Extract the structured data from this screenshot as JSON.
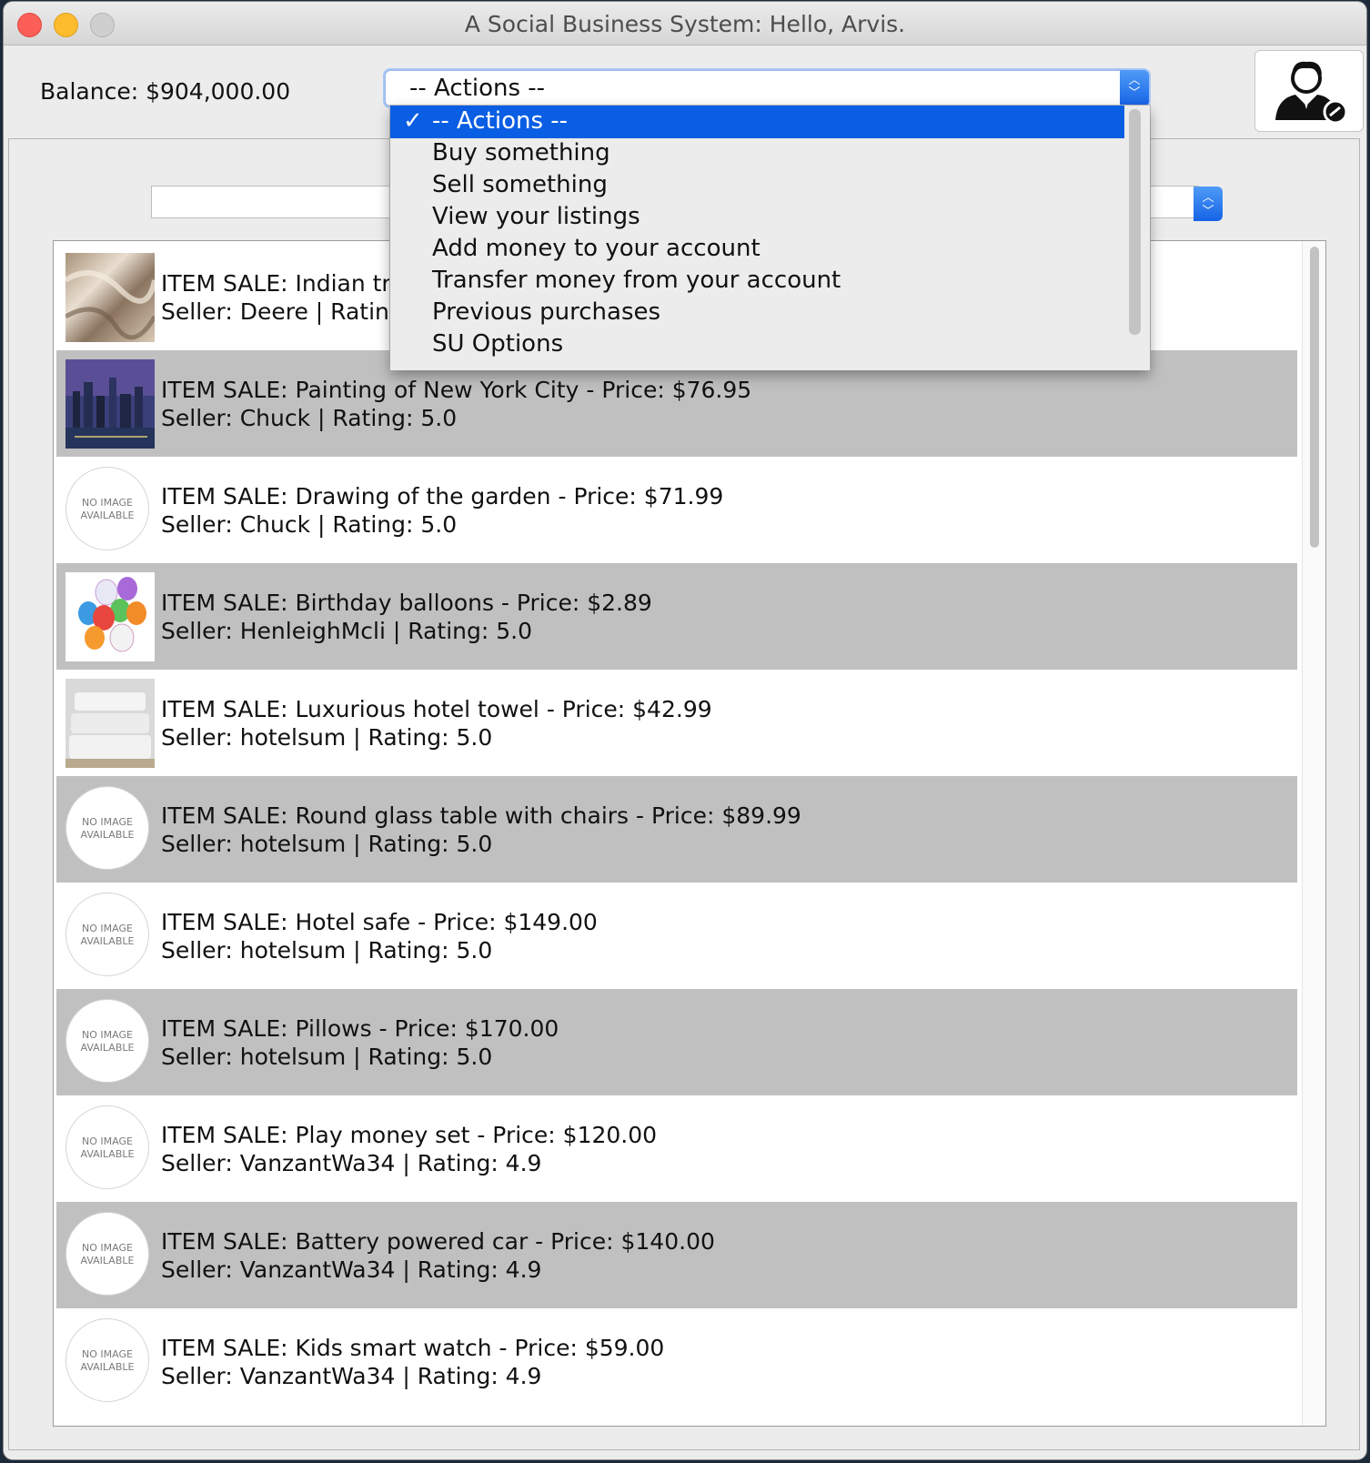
{
  "window": {
    "title": "A Social Business System: Hello, Arvis."
  },
  "header": {
    "balance_label": "Balance: $904,000.00",
    "actions_select_value": "-- Actions --",
    "account_icon": "user-account-icon"
  },
  "actions_menu": {
    "items": [
      {
        "label": "-- Actions --",
        "selected": true,
        "check": "✓"
      },
      {
        "label": "Buy something"
      },
      {
        "label": "Sell something"
      },
      {
        "label": "View your listings"
      },
      {
        "label": "Add money to your account"
      },
      {
        "label": "Transfer money from your account"
      },
      {
        "label": "Previous purchases"
      },
      {
        "label": "SU Options"
      }
    ]
  },
  "listings": {
    "no_image_text": [
      "NO IMAGE",
      "AVAILABLE"
    ],
    "items": [
      {
        "line1": "ITEM SALE: Indian tr",
        "line2": "Seller: Deere | Rating",
        "image": "satin-fabric"
      },
      {
        "line1": "ITEM SALE: Painting of New York City - Price: $76.95",
        "line2": "Seller: Chuck | Rating: 5.0",
        "image": "city-painting"
      },
      {
        "line1": "ITEM SALE: Drawing of the garden - Price: $71.99",
        "line2": "Seller: Chuck | Rating: 5.0",
        "image": "none"
      },
      {
        "line1": "ITEM SALE: Birthday balloons - Price: $2.89",
        "line2": "Seller: HenleighMcli | Rating: 5.0",
        "image": "balloons"
      },
      {
        "line1": "ITEM SALE: Luxurious hotel towel - Price: $42.99",
        "line2": "Seller: hotelsum | Rating: 5.0",
        "image": "towels"
      },
      {
        "line1": "ITEM SALE: Round glass table with chairs - Price: $89.99",
        "line2": "Seller: hotelsum | Rating: 5.0",
        "image": "none"
      },
      {
        "line1": "ITEM SALE: Hotel safe - Price: $149.00",
        "line2": "Seller: hotelsum | Rating: 5.0",
        "image": "none"
      },
      {
        "line1": "ITEM SALE: Pillows - Price: $170.00",
        "line2": "Seller: hotelsum | Rating: 5.0",
        "image": "none"
      },
      {
        "line1": "ITEM SALE: Play money set - Price: $120.00",
        "line2": "Seller: VanzantWa34 | Rating: 4.9",
        "image": "none"
      },
      {
        "line1": "ITEM SALE: Battery powered car - Price: $140.00",
        "line2": "Seller: VanzantWa34 | Rating: 4.9",
        "image": "none"
      },
      {
        "line1": "ITEM SALE: Kids smart watch - Price: $59.00",
        "line2": "Seller: VanzantWa34 | Rating: 4.9",
        "image": "none"
      }
    ]
  },
  "colors": {
    "accent": "#0a5ee3",
    "alt_row": "#c0c0c0",
    "close": "#fc5f57",
    "minimize": "#fdbc2e"
  }
}
